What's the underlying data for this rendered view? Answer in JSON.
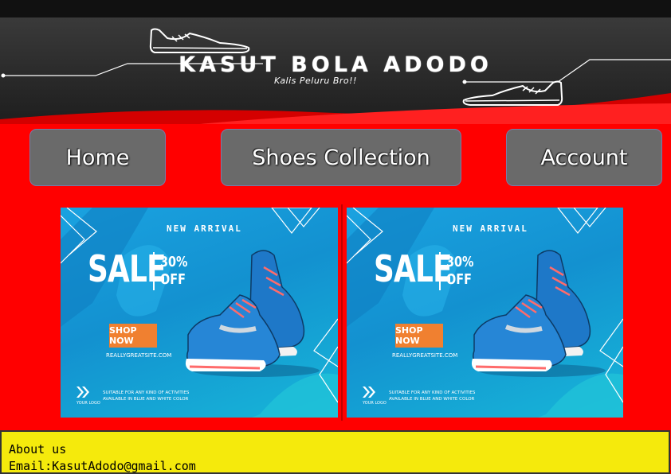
{
  "banner": {
    "title": "KASUT BOLA ADODO",
    "tagline": "Kalis Peluru Bro!!"
  },
  "nav": {
    "home": "Home",
    "shoes_collection": "Shoes Collection",
    "account": "Account"
  },
  "promos": [
    {
      "new_arrival": "NEW ARRIVAL",
      "sale": "SALE",
      "discount_line1": "30%",
      "discount_line2": "OFF",
      "cta": "SHOP NOW",
      "site": "REALLYGREATSITE.COM",
      "logo": "YOUR LOGO",
      "fine_line1": "SUITABLE FOR ANY KIND OF ACTIVITIES",
      "fine_line2": "AVAILABLE IN BLUE AND WHITE COLOR"
    },
    {
      "new_arrival": "NEW ARRIVAL",
      "sale": "SALE",
      "discount_line1": "30%",
      "discount_line2": "OFF",
      "cta": "SHOP NOW",
      "site": "REALLYGREATSITE.COM",
      "logo": "YOUR LOGO",
      "fine_line1": "SUITABLE FOR ANY KIND OF ACTIVITIES",
      "fine_line2": "AVAILABLE IN BLUE AND WHITE COLOR"
    }
  ],
  "footer": {
    "about": "About us",
    "email": "Email:KasutAdodo@gmail.com"
  },
  "colors": {
    "page_bg": "#ff0000",
    "nav_button": "#6a6a6a",
    "footer_bg": "#f5ea0c",
    "promo_bg": "#1aa2e0",
    "cta": "#f08030"
  },
  "icons": [
    "sneaker-outline-icon",
    "running-shoes-image",
    "chevrons-logo-icon"
  ]
}
